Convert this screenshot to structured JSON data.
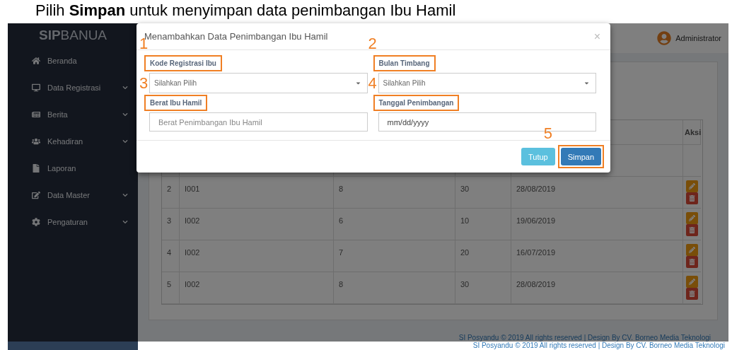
{
  "caption": "Pilih **Simpan** untuk menyimpan data penimbangan Ibu Hamil",
  "brand": {
    "strong": "SIP",
    "rest": "BANUA"
  },
  "sidebar": {
    "items": [
      {
        "label": "Beranda",
        "expandable": false
      },
      {
        "label": "Data Registrasi",
        "expandable": true
      },
      {
        "label": "Berita",
        "expandable": true
      },
      {
        "label": "Kehadiran",
        "expandable": true
      },
      {
        "label": "Laporan",
        "expandable": false
      },
      {
        "label": "Data Master",
        "expandable": true
      },
      {
        "label": "Pengaturan",
        "expandable": true
      }
    ]
  },
  "user": {
    "name": "Administrator"
  },
  "table": {
    "action_header": "Aksi",
    "rows": [
      {
        "cells": [
          "2",
          "I001",
          "8",
          "30",
          "28/08/2019"
        ]
      },
      {
        "cells": [
          "3",
          "I002",
          "6",
          "10",
          "19/06/2019"
        ]
      },
      {
        "cells": [
          "4",
          "I002",
          "7",
          "20",
          "16/07/2019"
        ]
      },
      {
        "cells": [
          "5",
          "I002",
          "8",
          "30",
          "28/08/2019"
        ]
      }
    ]
  },
  "footer": [
    "SI Posyandu © 2019 All rights reserved | Design By CV. Borneo Media Teknologi",
    "SI Posyandu © 2019 All rights reserved | Design By CV. Borneo Media Teknologi"
  ],
  "modal": {
    "title": "Menambahkan Data Penimbangan Ibu Hamil",
    "close": "×",
    "fields": [
      {
        "label": "Kode Registrasi Ibu",
        "kind": "select",
        "value": "Silahkan Pilih",
        "highlighted": true,
        "marker": "1"
      },
      {
        "label": "Bulan Timbang",
        "kind": "select",
        "value": "Silahkan Pilih",
        "highlighted": true,
        "marker": "2"
      },
      {
        "label": "Berat Ibu Hamil",
        "kind": "text",
        "placeholder": "Berat Penimbangan Ibu Hamil",
        "highlighted": true,
        "marker": "3"
      },
      {
        "label": "Tanggal Penimbangan",
        "kind": "date",
        "value": "mm/dd/yyyy",
        "highlighted": true,
        "marker": "4"
      }
    ],
    "buttons": [
      {
        "label": "Tutup",
        "kind": "info",
        "highlighted": false
      },
      {
        "label": "Simpan",
        "kind": "primary",
        "highlighted": true,
        "marker": "5"
      }
    ]
  }
}
